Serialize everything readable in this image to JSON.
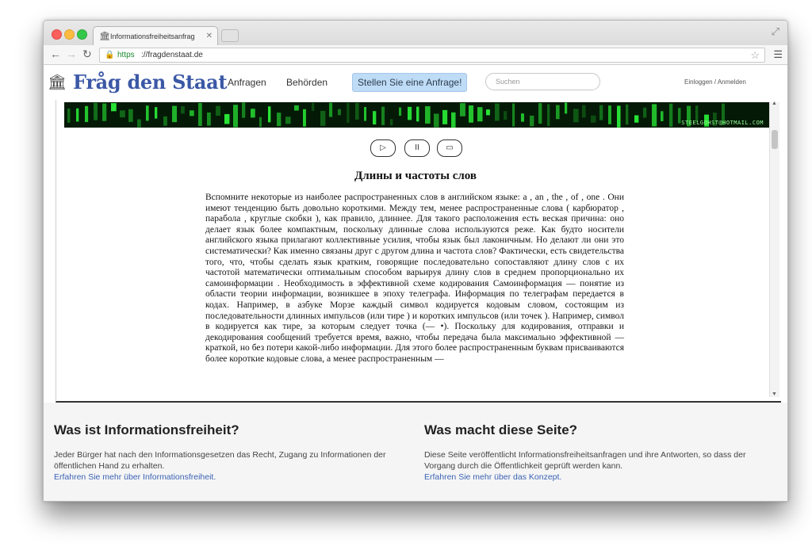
{
  "browser": {
    "tab_title": "Informationsfreiheitsanfrag",
    "url_scheme": "https",
    "url_rest": "://fragdenstaat.de"
  },
  "site": {
    "logo": "Fråg den Staat",
    "nav": [
      "Anfragen",
      "Behörden"
    ],
    "cta": "Stellen Sie eine Anfrage!",
    "search_placeholder": "Suchen",
    "login": "Einloggen / Anmelden"
  },
  "banner": {
    "email": "STEELGOHST@HOTMAIL.COM",
    "accent": "#2dff3c"
  },
  "media_controls": {
    "play_icon": "▷",
    "pause_icon": "II",
    "stop_icon": "▭"
  },
  "article": {
    "title": "Длины и частоты слов",
    "body": "Вспомните некоторые из наиболее распространенных слов в английском языке: a , an , the , of , one . Они имеют тенденцию быть довольно короткими. Между тем, менее распространенные слова ( карбюратор , парабола , круглые скобки ), как правило, длиннее. Для такого расположения есть веская причина: оно делает язык более компактным, поскольку длинные слова используются реже. Как будто носители английского языка прилагают коллективные усилия, чтобы язык был лаконичным. Но делают ли они это систематически? Как именно связаны друг с другом длина и частота слов? Фактически, есть свидетельства того, что, чтобы сделать язык кратким, говорящие последовательно сопоставляют длину слов с их частотой математически оптимальным способом      варьируя длину слов в среднем пропорционально их самоинформации . Необходимость в эффективной схеме кодирования Самоинформация — понятие из области теории информации, возникшее в эпоху телеграфа. Информация по телеграфам передается в кодах. Например, в азбуке Морзе каждый символ кодируется кодовым словом, состоящим из последовательности длинных импульсов (или тире ) и коротких импульсов (или точек ). Например, символ в кодируется как тире, за которым следует точка (— •). Поскольку для кодирования, отправки и декодирования сообщений требуется время, важно, чтобы передача была максимально эффективной — краткой, но без потери какой-либо информации. Для этого более распространенным буквам присваиваются более короткие кодовые слова, а менее распространенным —"
  },
  "info": {
    "left": {
      "title": "Was ist Informationsfreiheit?",
      "text": "Jeder Bürger hat nach den Informationsgesetzen das Recht, Zugang zu Informationen der öffentlichen Hand zu erhalten.",
      "link": "Erfahren Sie mehr über Informationsfreiheit."
    },
    "right": {
      "title": "Was macht diese Seite?",
      "text": "Diese Seite veröffentlicht Informationsfreiheitsanfragen und ihre Antworten, so dass der Vorgang durch die Öffentlichkeit geprüft werden kann.",
      "link": "Erfahren Sie mehr über das Konzept."
    }
  }
}
